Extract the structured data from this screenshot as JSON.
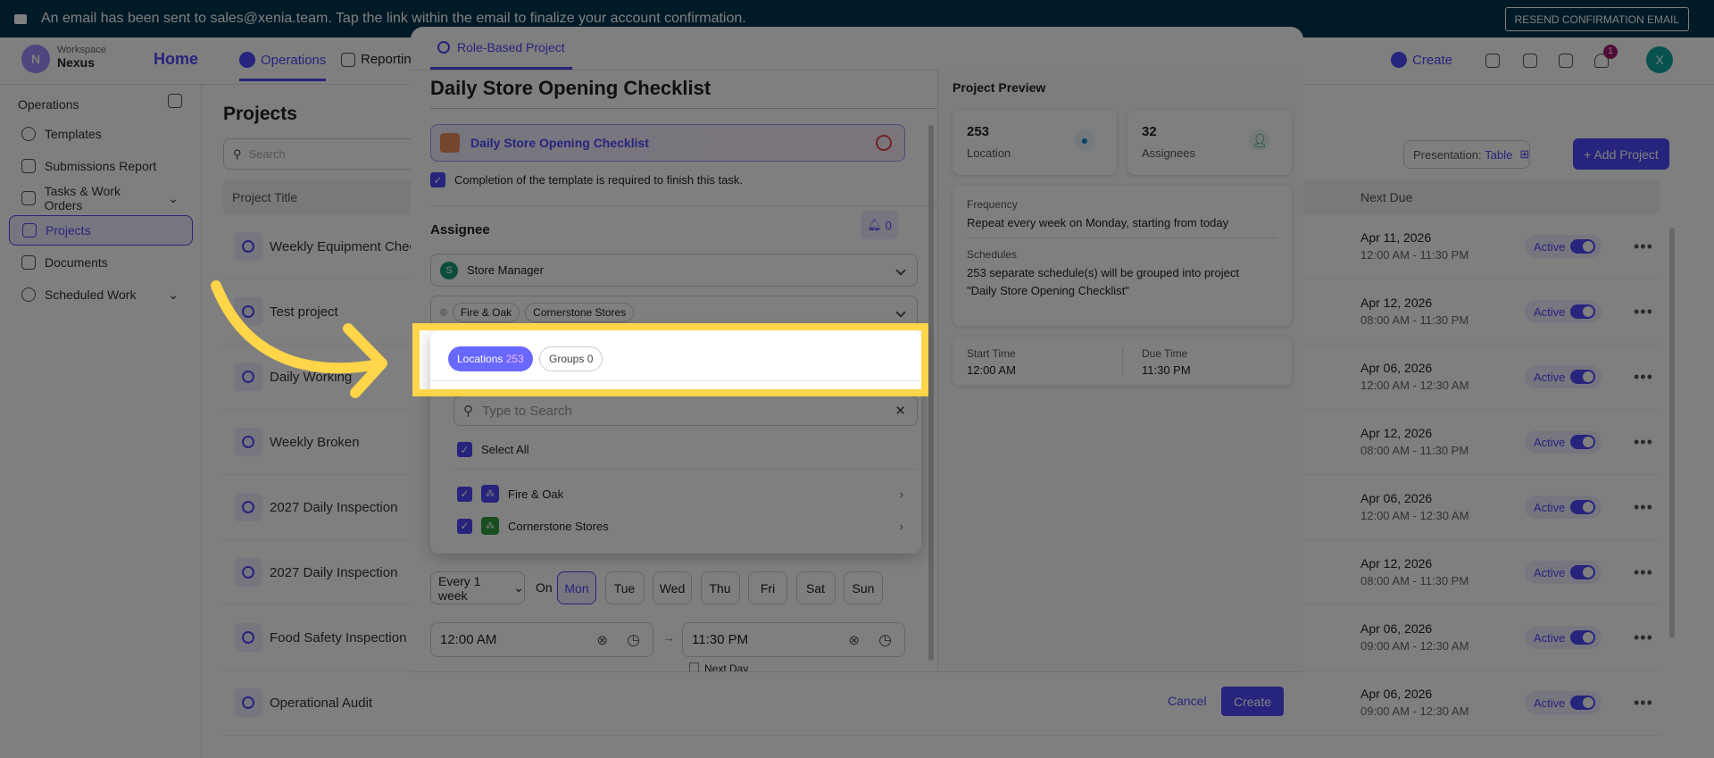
{
  "banner": {
    "message": "An email has been sent to sales@xenia.team. Tap the link within the email to finalize your account confirmation.",
    "resend": "RESEND CONFIRMATION EMAIL"
  },
  "header": {
    "workspace_label": "Workspace",
    "workspace_name": "Nexus",
    "workspace_initial": "N",
    "nav": [
      "Home",
      "Operations",
      "Reporting"
    ],
    "create": "Create",
    "notification_count": "1",
    "user_initial": "X"
  },
  "sidebar": {
    "section": "Operations",
    "items": [
      "Templates",
      "Submissions Report",
      "Tasks & Work Orders",
      "Projects",
      "Documents",
      "Scheduled Work"
    ]
  },
  "main": {
    "title": "Projects",
    "search_placeholder": "Search",
    "presentation_label": "Presentation:",
    "presentation_value": "Table",
    "add_project": "+ Add Project",
    "col_title": "Project Title",
    "col_next_due": "Next Due",
    "rows": [
      {
        "title": "Weekly Equipment Check",
        "date": "Apr 11, 2026",
        "time": "12:00 AM - 11:30 PM",
        "status": "Active"
      },
      {
        "title": "Test project",
        "date": "Apr 12, 2026",
        "time": "08:00 AM - 11:30 PM",
        "status": "Active"
      },
      {
        "title": "Daily Working",
        "date": "Apr 06, 2026",
        "time": "12:00 AM - 12:30 AM",
        "status": "Active"
      },
      {
        "title": "Weekly Broken",
        "date": "Apr 12, 2026",
        "time": "08:00 AM - 11:30 PM",
        "status": "Active"
      },
      {
        "title": "2027 Daily Inspection",
        "date": "Apr 06, 2026",
        "time": "12:00 AM - 12:30 AM",
        "status": "Active"
      },
      {
        "title": "2027 Daily Inspection",
        "date": "Apr 12, 2026",
        "time": "08:00 AM - 11:30 PM",
        "status": "Active"
      },
      {
        "title": "Food Safety Inspection",
        "date": "Apr 06, 2026",
        "time": "09:00 AM - 12:30 AM",
        "status": "Active"
      },
      {
        "title": "Operational Audit",
        "date": "Apr 06, 2026",
        "time": "09:00 AM - 12:30 AM",
        "status": "Active"
      }
    ]
  },
  "modal": {
    "tab": "Role-Based Project",
    "title": "Daily Store Opening Checklist",
    "template": "Daily Store Opening Checklist",
    "required_text": "Completion of the template is required to finish this task.",
    "assignee_label": "Assignee",
    "bell_count": "0",
    "role": "Store Manager",
    "role_initial": "S",
    "location_tags": [
      "Fire & Oak",
      "Cornerstone Stores"
    ],
    "dropdown": {
      "locations_label": "Locations",
      "locations_count": "253",
      "groups_label": "Groups",
      "groups_count": "0",
      "search_placeholder": "Type to Search",
      "select_all": "Select All",
      "items": [
        "Fire & Oak",
        "Cornerstone Stores"
      ]
    },
    "frequency": "Every 1 week",
    "on": "On",
    "days": [
      "Mon",
      "Tue",
      "Wed",
      "Thu",
      "Fri",
      "Sat",
      "Sun"
    ],
    "selected_day": "Mon",
    "start_time": "12:00 AM",
    "due_time": "11:30 PM",
    "next_day": "Next Day",
    "cancel": "Cancel",
    "create": "Create",
    "preview": {
      "title": "Project Preview",
      "location_count": "253",
      "location_label": "Location",
      "assignee_count": "32",
      "assignee_label": "Assignees",
      "frequency_label": "Frequency",
      "frequency_text": "Repeat every week on Monday, starting from today",
      "schedules_label": "Schedules",
      "schedules_text": "253 separate schedule(s) will be grouped into project \"Daily Store Opening Checklist\"",
      "start_label": "Start Time",
      "start_value": "12:00 AM",
      "due_label": "Due Time",
      "due_value": "11:30 PM"
    }
  },
  "colors": {
    "primary": "#4e48fa",
    "highlight": "#ffd54a",
    "banner": "#02344f"
  }
}
